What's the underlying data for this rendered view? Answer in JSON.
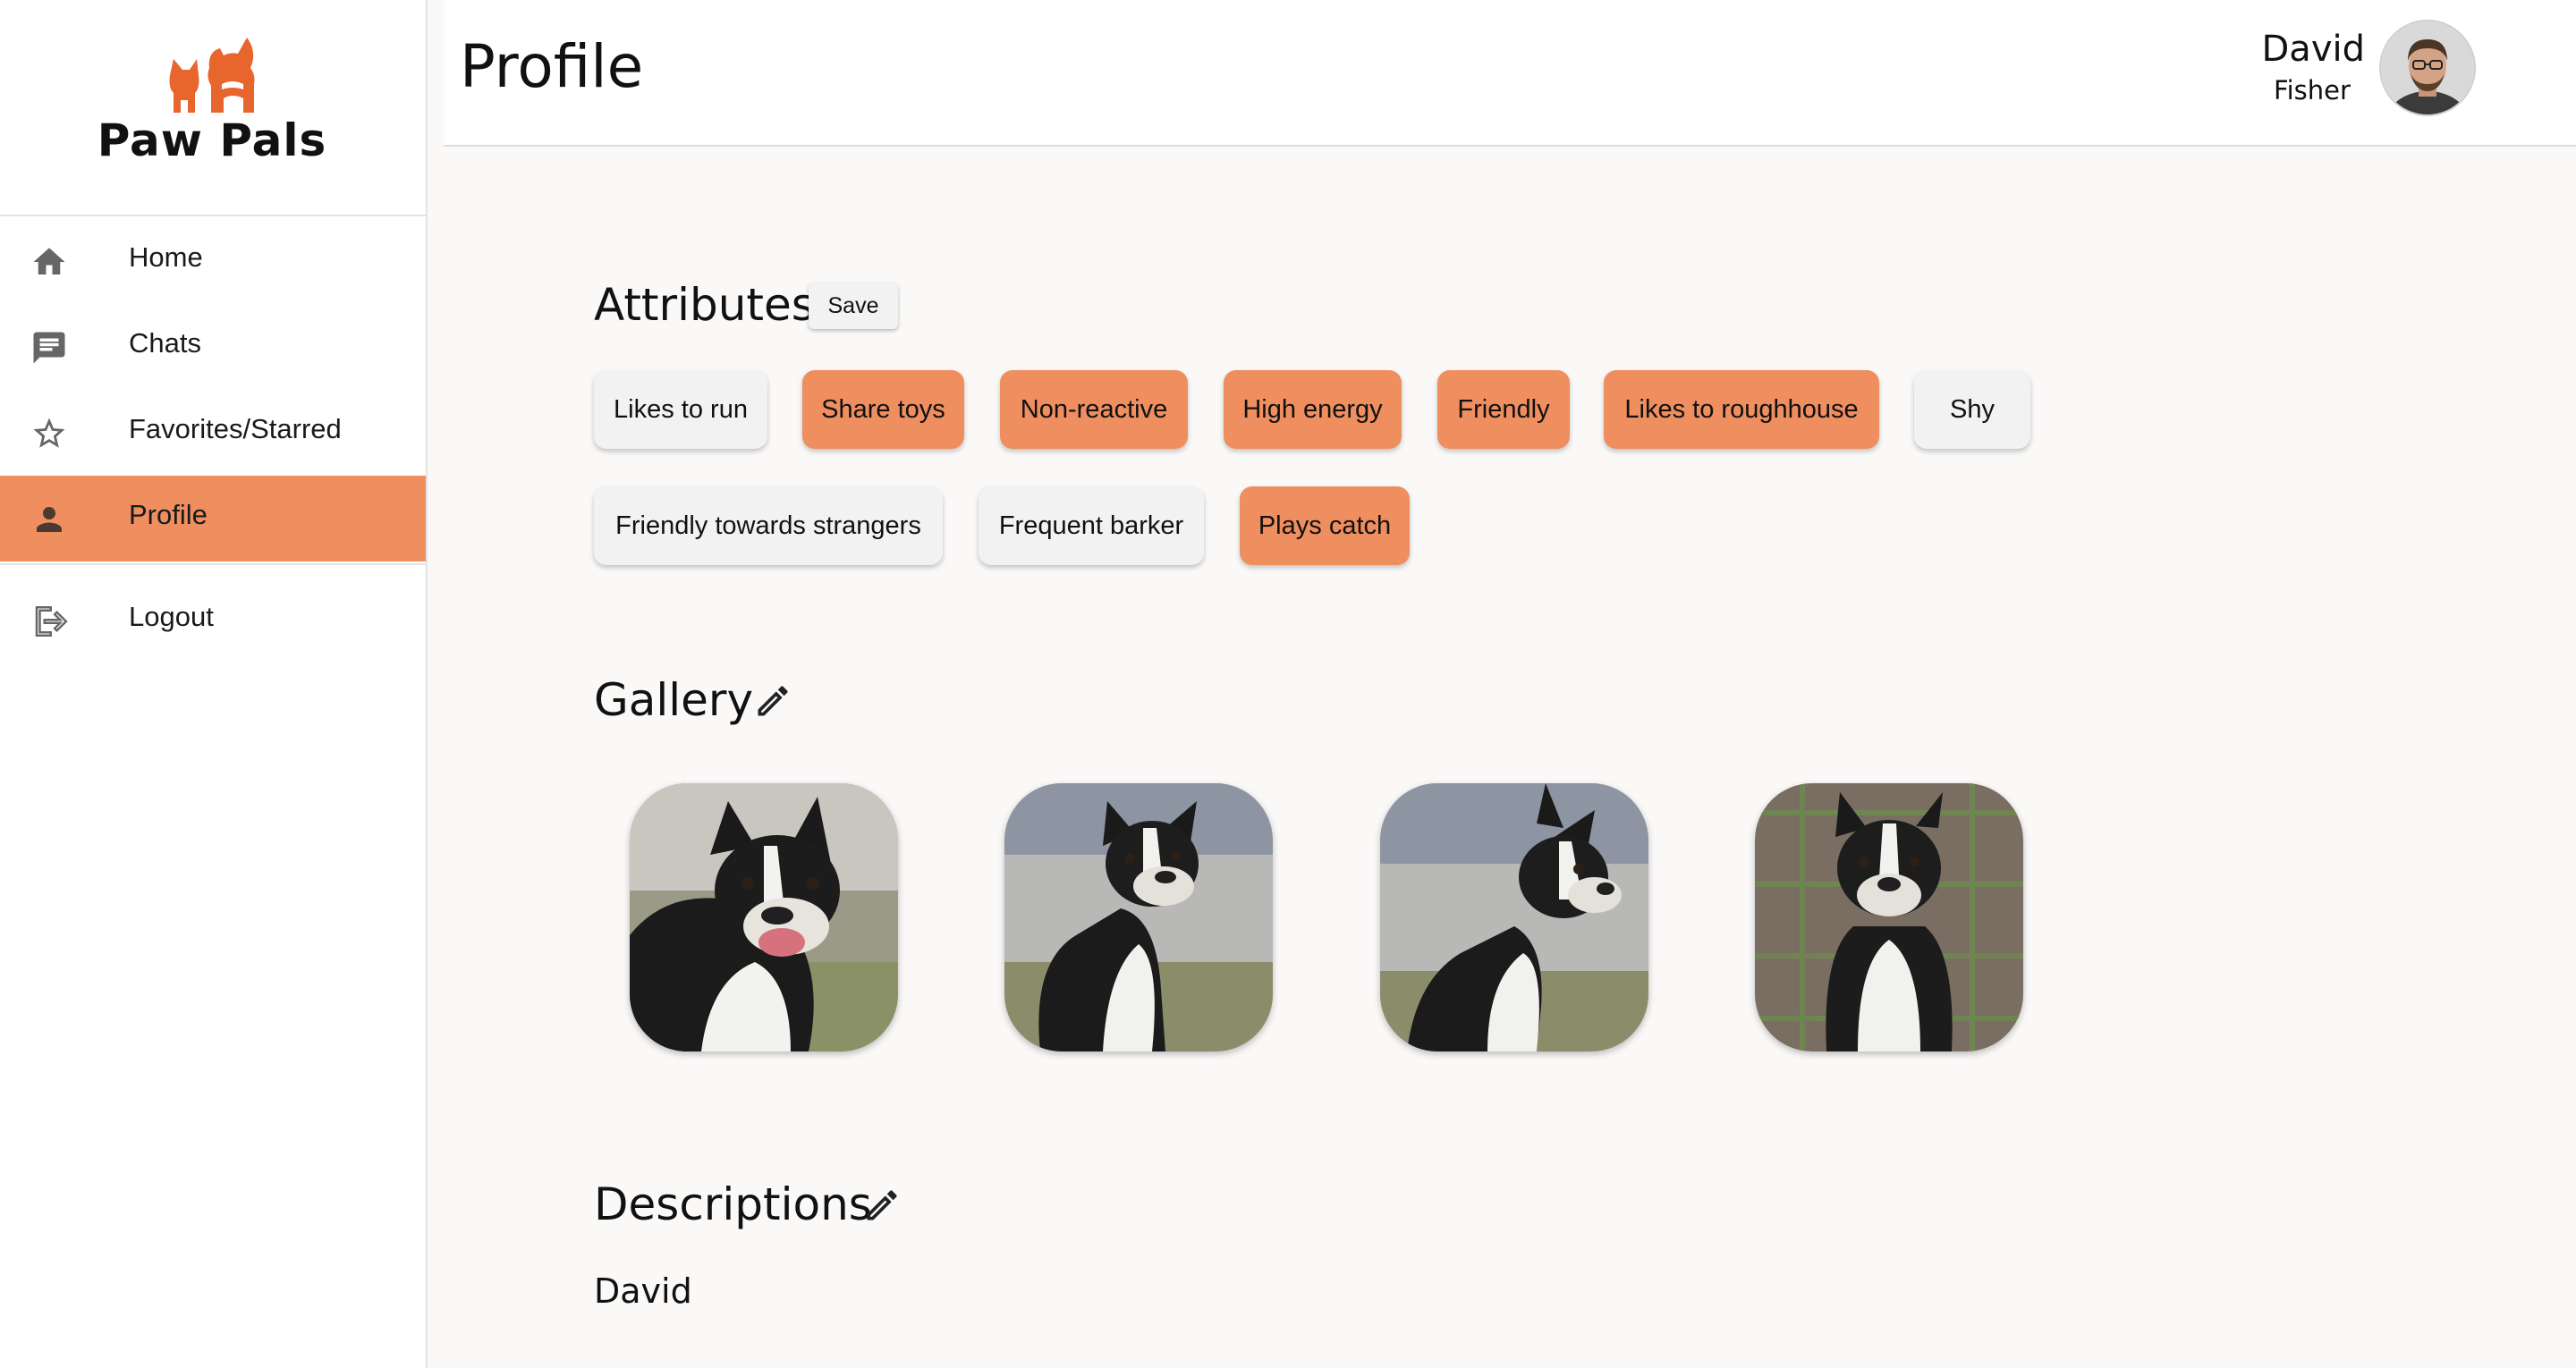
{
  "brand": {
    "name": "Paw Pals",
    "accent": "#ef8e5f",
    "logo_color": "#e8652e"
  },
  "sidebar": {
    "items": [
      {
        "label": "Home",
        "icon": "home-icon",
        "active": false
      },
      {
        "label": "Chats",
        "icon": "chat-icon",
        "active": false
      },
      {
        "label": "Favorites/Starred",
        "icon": "star-outline-icon",
        "active": false
      },
      {
        "label": "Profile",
        "icon": "person-icon",
        "active": true
      },
      {
        "label": "Logout",
        "icon": "logout-icon",
        "active": false
      }
    ]
  },
  "header": {
    "title": "Profile",
    "user": {
      "first_name": "David",
      "last_name": "Fisher"
    }
  },
  "attributes": {
    "title": "Attributes",
    "save_label": "Save",
    "chips": [
      {
        "label": "Likes to run",
        "selected": false
      },
      {
        "label": "Share toys",
        "selected": true
      },
      {
        "label": "Non-reactive",
        "selected": true
      },
      {
        "label": "High energy",
        "selected": true
      },
      {
        "label": "Friendly",
        "selected": true
      },
      {
        "label": "Likes to roughhouse",
        "selected": true
      },
      {
        "label": "Shy",
        "selected": false
      },
      {
        "label": "Friendly towards strangers",
        "selected": false
      },
      {
        "label": "Frequent barker",
        "selected": false
      },
      {
        "label": "Plays catch",
        "selected": true
      }
    ]
  },
  "gallery": {
    "title": "Gallery",
    "photo_count": 4
  },
  "descriptions": {
    "title": "Descriptions",
    "text": "David"
  }
}
